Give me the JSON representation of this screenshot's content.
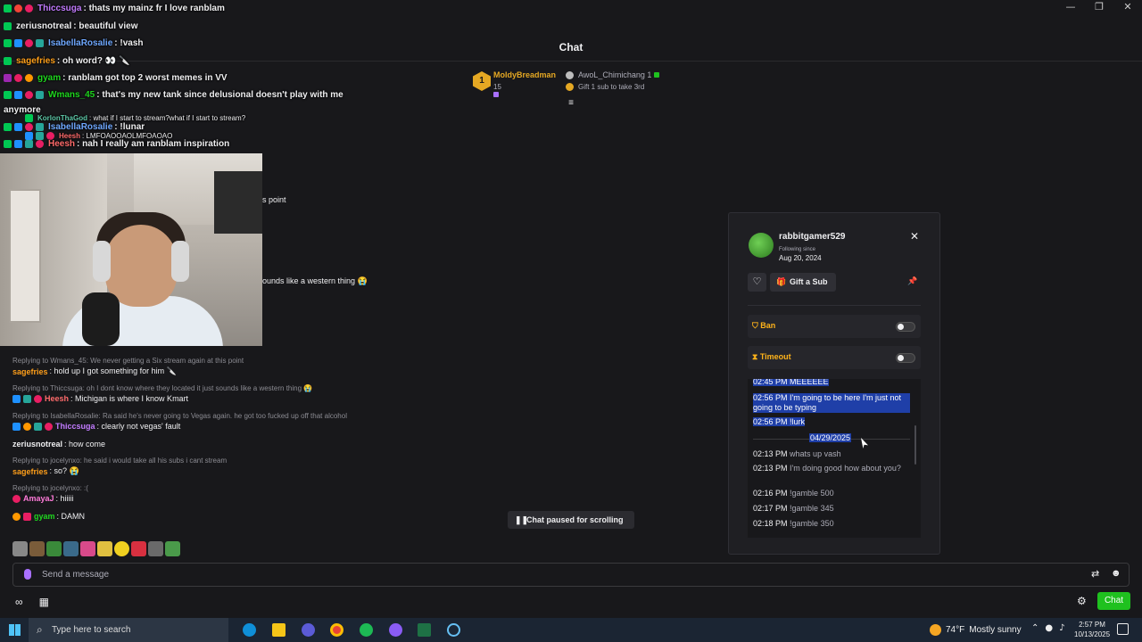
{
  "window": {
    "title_fragment": "Chat",
    "controls": [
      "minimize",
      "restore",
      "close"
    ]
  },
  "overlay_chat": [
    {
      "name": "Thiccsuga",
      "name_color": "#c27bff",
      "text": ": thats my mainz fr I love ranblam"
    },
    {
      "name": "zeriusnotreal",
      "name_color": "#efeff1",
      "text": ": beautiful view"
    },
    {
      "name": "IsabellaRosalie",
      "name_color": "#6fa8ff",
      "text": ": !vash"
    },
    {
      "name": "sagefries",
      "name_color": "#ff9f1a",
      "text": ": oh word? 👀 🔪"
    },
    {
      "name": "gyam",
      "name_color": "#1fd61f",
      "text": ": ranblam got top 2 worst memes in VV"
    },
    {
      "name": "Wmans_45",
      "name_color": "#1fd61f",
      "text": ": that's my new tank since delusional doesn't play with me"
    },
    {
      "name": "",
      "name_color": "#efeff1",
      "text": "anymore"
    },
    {
      "name": "KorlonThaGod",
      "name_color": "#5ec8a8",
      "text": ": what if I start to stream?what if I start to stream?"
    },
    {
      "name": "IsabellaRosalie",
      "name_color": "#6fa8ff",
      "text": ": !lunar"
    },
    {
      "name": "Heesh",
      "name_color": "#ff6b6b",
      "text": ": LMFOAOOAOLMFOAOAO"
    },
    {
      "name": "Heesh",
      "name_color": "#ff6b6b",
      "text": ": nah I really am ranblam inspiration"
    }
  ],
  "chat_fragments": {
    "frag1": "s point",
    "frag2": "ounds like a western thing 😭"
  },
  "lower_chat": [
    {
      "kind": "reply",
      "text": "Replying to Wmans_45: We never getting a Six stream again at this point"
    },
    {
      "kind": "msg",
      "name": "sagefries",
      "name_color": "#ff9f1a",
      "text": ": hold up I got something for him 🔪"
    },
    {
      "kind": "reply",
      "text": "Replying to Thiccsuga: oh I dont know where they located it just sounds like a western thing 😭"
    },
    {
      "kind": "msg",
      "name": "Heesh",
      "name_color": "#ff6b6b",
      "text": ": Michigan is where I know Kmart"
    },
    {
      "kind": "reply",
      "text": "Replying to IsabellaRosalie: Ra said he's never going to Vegas again. he got too fucked up off that alcohol"
    },
    {
      "kind": "msg",
      "name": "Thiccsuga",
      "name_color": "#c27bff",
      "text": ": clearly not vegas' fault"
    },
    {
      "kind": "msg",
      "name": "zeriusnotreal",
      "name_color": "#efeff1",
      "text": ": how come"
    },
    {
      "kind": "reply",
      "text": "Replying to jocelynxo: he said i would take all his subs i cant stream"
    },
    {
      "kind": "msg",
      "name": "sagefries",
      "name_color": "#ff9f1a",
      "text": ": so? 😭"
    },
    {
      "kind": "reply",
      "text": "Replying to jocelynxo: :("
    },
    {
      "kind": "msg",
      "name": "AmayaJ",
      "name_color": "#ff7ad9",
      "text": ": hiiiii"
    },
    {
      "kind": "msg",
      "name": "gyam",
      "name_color": "#1fd61f",
      "text": ": DAMN"
    }
  ],
  "leaderboard": {
    "rank": "1",
    "top_user": "MoldyBreadman",
    "top_count": "15",
    "second_user": "AwoL_Chimichang",
    "second_count": "1",
    "gift_note": "Gift 1 sub to take 3rd"
  },
  "user_card": {
    "username": "rabbitgamer529",
    "following_label": "Following since",
    "following_date": "Aug 20, 2024",
    "gift_sub_label": "Gift a Sub",
    "ban_label": "Ban",
    "timeout_label": "Timeout",
    "ban_enabled": false,
    "timeout_enabled": false,
    "history_date": "04/29/2025",
    "history": [
      {
        "time": "02:45 PM",
        "text": "MEEEEEE",
        "selected": true
      },
      {
        "time": "02:56 PM",
        "text": "I'm going to be here I'm just not going to be typing",
        "selected": true
      },
      {
        "time": "02:56 PM",
        "text": "!lurk",
        "selected": true
      },
      {
        "time": "02:13 PM",
        "text": "whats up vash",
        "selected": false
      },
      {
        "time": "02:13 PM",
        "text": "I'm doing good how about you?",
        "selected": false
      },
      {
        "time": "02:16 PM",
        "text": "!gamble 500",
        "selected": false
      },
      {
        "time": "02:17 PM",
        "text": "!gamble 345",
        "selected": false
      },
      {
        "time": "02:18 PM",
        "text": "!gamble 350",
        "selected": false
      }
    ]
  },
  "paused_label": "Chat paused for scrolling",
  "input": {
    "placeholder": "Send a message"
  },
  "chat_button_label": "Chat",
  "taskbar": {
    "search_placeholder": "Type here to search",
    "temperature": "74°F",
    "weather": "Mostly sunny",
    "time": "2:57 PM",
    "date": "10/13/2025"
  },
  "colors": {
    "accent_green": "#1fc11f",
    "selection_blue": "#1f3fa8",
    "mod_gold": "#ffb31a"
  }
}
